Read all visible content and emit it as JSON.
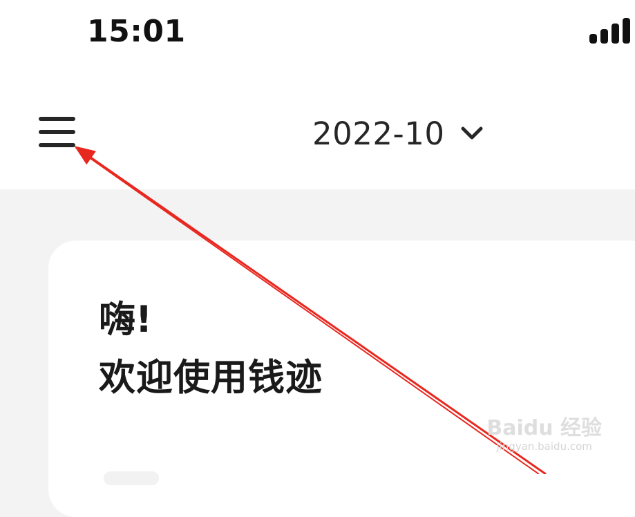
{
  "status_bar": {
    "time": "15:01",
    "signal_icon": "cellular-signal-icon"
  },
  "nav": {
    "menu_icon": "hamburger-menu-icon",
    "date": "2022-10",
    "dropdown_icon": "chevron-down-icon"
  },
  "card": {
    "greeting": "嗨!",
    "welcome": "欢迎使用钱迹"
  },
  "annotation": {
    "arrow_color": "#e8281f",
    "watermark_brand": "Baidu 经验",
    "watermark_url": "jingyan.baidu.com"
  }
}
